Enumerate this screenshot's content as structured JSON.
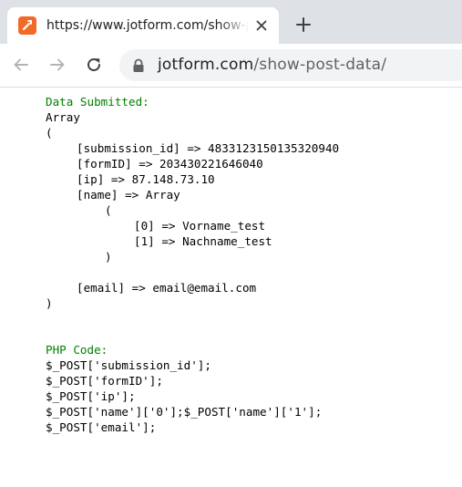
{
  "browser": {
    "tab_title": "https://www.jotform.com/show-post-data/",
    "url_host": "jotform.com",
    "url_path": "/show-post-data/",
    "icons": [
      "jotform-favicon-icon",
      "close-icon",
      "plus-icon",
      "back-arrow-icon",
      "forward-arrow-icon",
      "reload-icon",
      "lock-icon"
    ],
    "colors": {
      "favicon": "#f26a27",
      "tabstrip": "#dee1e6",
      "omnibox": "#f1f3f4"
    }
  },
  "page": {
    "data_heading": "Data Submitted:",
    "array_word": "Array",
    "open_paren": "(",
    "submission_line": "[submission_id] => 483312315013532094​0",
    "form_line": "[formID] => 203430221646040",
    "ip_line": "[ip] => 87.148.73.10",
    "name_line": "[name] => Array",
    "name_open": "(",
    "name_0": "[0] => Vorname_test",
    "name_1": "[1] => Nachname_test",
    "name_close": ")",
    "email_line": "[email] => email@email.com",
    "close_paren": ")",
    "php_heading": "PHP Code:",
    "php_lines": [
      "$_POST['submission_id'];",
      "$_POST['formID'];",
      "$_POST['ip'];",
      "$_POST['name']['0'];$_POST['name']['1'];",
      "$_POST['email'];"
    ],
    "colors": {
      "heading": "#008000",
      "text": "#000000"
    }
  }
}
